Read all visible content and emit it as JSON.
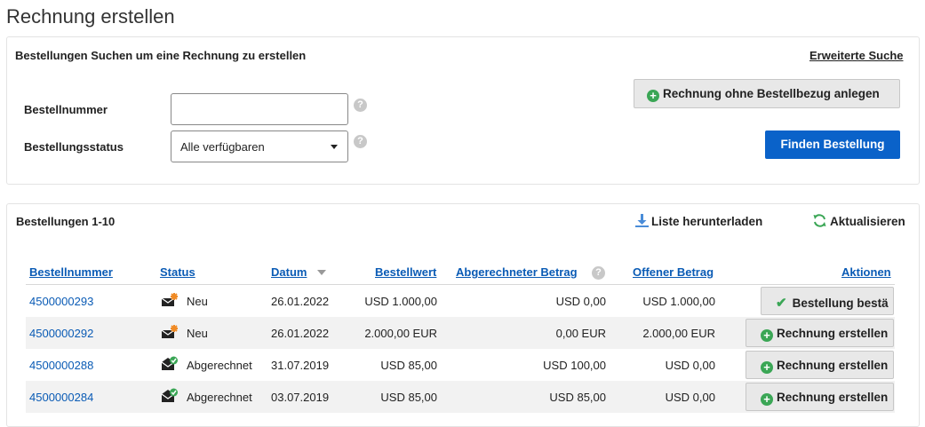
{
  "page_title": "Rechnung erstellen",
  "search": {
    "title": "Bestellungen Suchen um eine Rechnung zu erstellen",
    "advanced_link": "Erweiterte Suche",
    "order_number_label": "Bestellnummer",
    "order_number_value": "",
    "order_status_label": "Bestellungsstatus",
    "order_status_value": "Alle verfügbaren",
    "help_glyph": "?",
    "create_without_po": "Rechnung ohne Bestellbezug anlegen",
    "find_button": "Finden Bestellung"
  },
  "orders": {
    "title": "Bestellungen 1-10",
    "download": "Liste herunterladen",
    "refresh": "Aktualisieren",
    "columns": {
      "number": "Bestellnummer",
      "status": "Status",
      "date": "Datum",
      "value": "Bestellwert",
      "invoiced": "Abgerechneter Betrag",
      "open": "Offener Betrag",
      "actions": "Aktionen"
    },
    "rows": [
      {
        "number": "4500000293",
        "status": "Neu",
        "status_icon": "new-mail-icon",
        "date": "26.01.2022",
        "value": "USD 1.000,00",
        "invoiced": "USD 0,00",
        "open": "USD 1.000,00",
        "action": "Bestellung bestä",
        "action_icon": "check-icon"
      },
      {
        "number": "4500000292",
        "status": "Neu",
        "status_icon": "new-mail-icon",
        "date": "26.01.2022",
        "value": "2.000,00 EUR",
        "invoiced": "0,00 EUR",
        "open": "2.000,00 EUR",
        "action": "Rechnung erstellen",
        "action_icon": "plus-icon"
      },
      {
        "number": "4500000288",
        "status": "Abgerechnet",
        "status_icon": "invoiced-mail-icon",
        "date": "31.07.2019",
        "value": "USD 85,00",
        "invoiced": "USD 100,00",
        "open": "USD 0,00",
        "action": "Rechnung erstellen",
        "action_icon": "plus-icon"
      },
      {
        "number": "4500000284",
        "status": "Abgerechnet",
        "status_icon": "invoiced-mail-icon",
        "date": "03.07.2019",
        "value": "USD 85,00",
        "invoiced": "USD 85,00",
        "open": "USD 0,00",
        "action": "Rechnung erstellen",
        "action_icon": "plus-icon"
      }
    ]
  },
  "colors": {
    "link": "#0a5bb5",
    "primary_button": "#0a62c9",
    "success": "#3aa655",
    "new_badge": "#f08a24"
  }
}
